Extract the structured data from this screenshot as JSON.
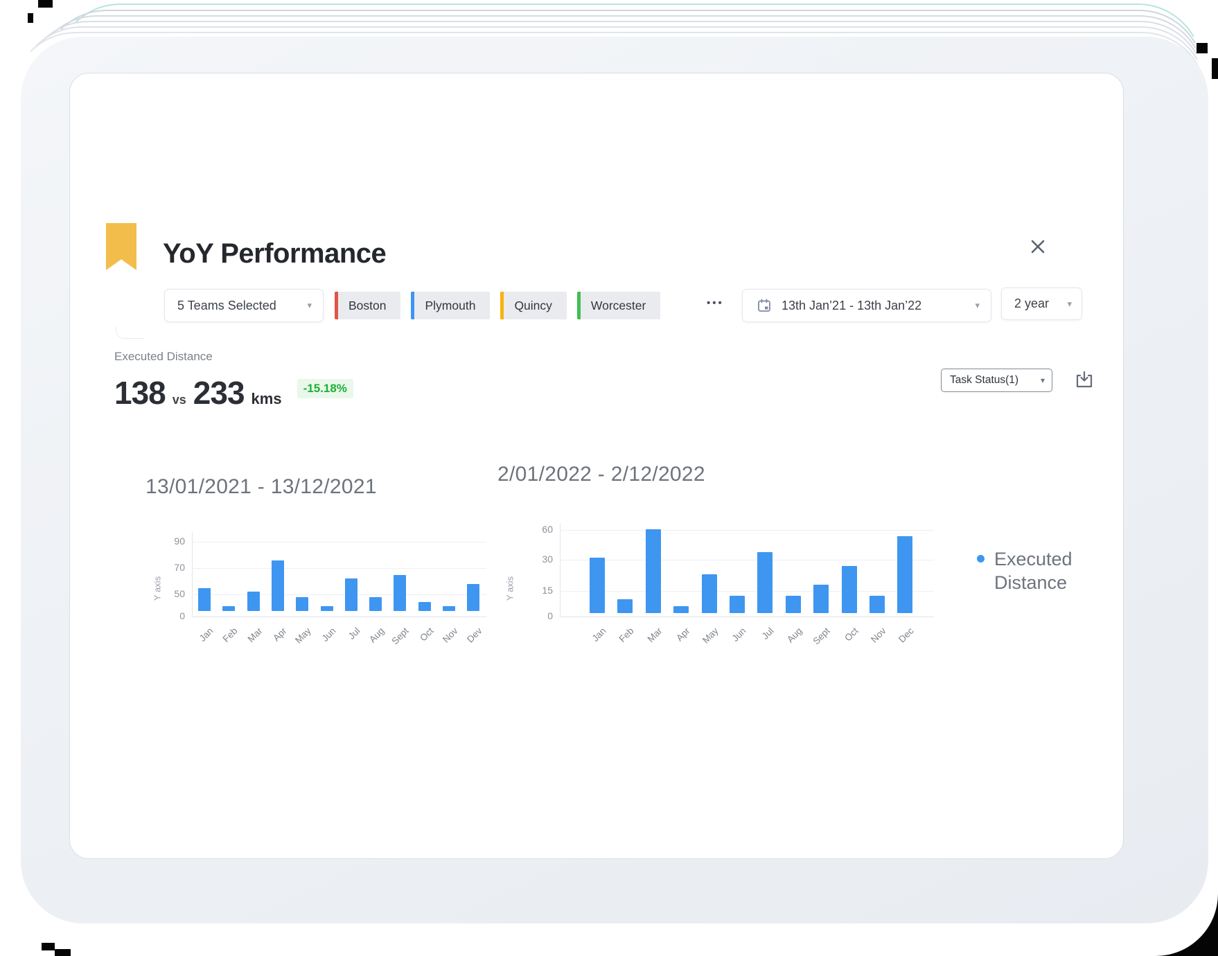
{
  "header": {
    "title": "YoY Performance",
    "icons": {
      "bookmark": "bookmark-ribbon",
      "close": "✕"
    }
  },
  "filter_bar": {
    "teams_dropdown": {
      "value": "5 Teams Selected",
      "caret": "▾"
    },
    "team_chips": [
      {
        "label": "Boston",
        "color": "#E25449"
      },
      {
        "label": "Plymouth",
        "color": "#3E96F1"
      },
      {
        "label": "Quincy",
        "color": "#F6B40D"
      },
      {
        "label": "Worcester",
        "color": "#40BE52"
      }
    ],
    "more_teams": "•••",
    "date_range": {
      "value": "13th Jan’21 - 13th Jan’22",
      "caret": "▾",
      "icon": "calendar"
    },
    "period_dropdown": {
      "value": "2 year",
      "caret": "▾"
    }
  },
  "kpi": {
    "label": "Executed Distance",
    "current_value": "138",
    "separator": "vs",
    "previous_value": "233",
    "unit": "kms",
    "change_badge": {
      "text": "-15.18%",
      "color": "#1FAE35",
      "background": "#E9F8EB"
    }
  },
  "toolbar": {
    "task_status_dropdown": {
      "value": "Task Status(1)",
      "caret": "▾"
    },
    "download_icon": "download-tray"
  },
  "legend": {
    "marker_color": "#3E96F1",
    "label": "Executed Distance",
    "position": "right"
  },
  "chart_data": [
    {
      "type": "bar",
      "title": "13/01/2021 - 13/12/2021",
      "ylabel": "Y axis",
      "yticks": [
        90,
        70,
        50,
        0
      ],
      "ylim": [
        0,
        100
      ],
      "grid": true,
      "bar_color": "#3E96F1",
      "categories": [
        "Jan",
        "Feb",
        "Mar",
        "Apr",
        "May",
        "Jun",
        "Jul",
        "Aug",
        "Sept",
        "Oct",
        "Nov",
        "Dev"
      ],
      "series": [
        {
          "name": "Executed Distance",
          "values": [
            55,
            23,
            52,
            76,
            44,
            23,
            62,
            44,
            65,
            33,
            23,
            58
          ]
        }
      ]
    },
    {
      "type": "bar",
      "title": "2/01/2022 - 2/12/2022",
      "ylabel": "Y axis",
      "yticks": [
        60,
        30,
        15,
        0
      ],
      "ylim": [
        0,
        65
      ],
      "grid": true,
      "bar_color": "#3E96F1",
      "categories": [
        "Jan",
        "Feb",
        "Mar",
        "Apr",
        "May",
        "Jun",
        "Jul",
        "Aug",
        "Sept",
        "Oct",
        "Nov",
        "Dec"
      ],
      "series": [
        {
          "name": "Executed Distance",
          "values": [
            32,
            10,
            61,
            6,
            23,
            12,
            38,
            12,
            18,
            27,
            12,
            54
          ]
        }
      ]
    }
  ]
}
